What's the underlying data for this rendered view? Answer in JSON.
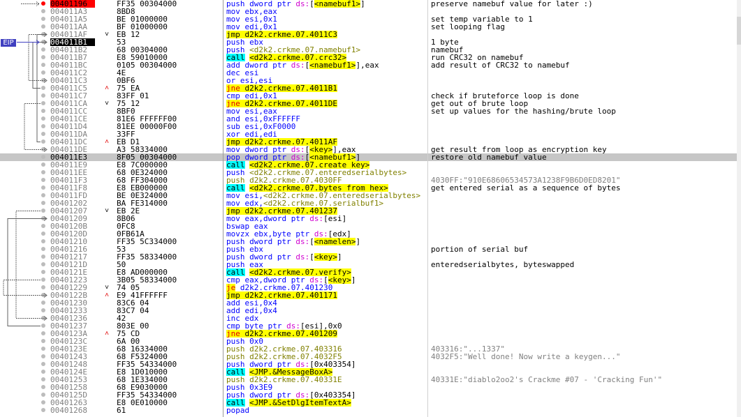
{
  "eip_label": "EIP",
  "rows": [
    {
      "addr": "00401196",
      "bytes": "FF35 00304000",
      "arrow": "",
      "ins": [
        [
          "push dword ptr ",
          ""
        ],
        [
          "ds:",
          "dk"
        ],
        [
          "[",
          "o"
        ],
        [
          "<namebuf1>",
          "sym"
        ],
        [
          "]",
          "o"
        ]
      ],
      "comment": "preserve namebuf value for later :)",
      "bp": true
    },
    {
      "addr": "004011A3",
      "bytes": "8BD8",
      "arrow": "",
      "ins": [
        [
          "mov ebx,eax",
          ""
        ]
      ],
      "comment": ""
    },
    {
      "addr": "004011A5",
      "bytes": "BE 01000000",
      "arrow": "",
      "ins": [
        [
          "mov esi,0x1",
          ""
        ]
      ],
      "comment": "set temp variable to 1"
    },
    {
      "addr": "004011AA",
      "bytes": "BF 01000000",
      "arrow": "",
      "ins": [
        [
          "mov edi,0x1",
          ""
        ]
      ],
      "comment": "set looping flag"
    },
    {
      "addr": "004011AF",
      "bytes": "EB 12",
      "arrow": "v",
      "ins": [
        [
          "jmp d2k2.crkme.07.4011C3",
          "jmp"
        ]
      ],
      "comment": ""
    },
    {
      "addr": "004011B1",
      "bytes": "53",
      "arrow": "",
      "ins": [
        [
          "push ebx",
          ""
        ]
      ],
      "comment": "1 byte",
      "eip": true
    },
    {
      "addr": "004011B2",
      "bytes": "68 00304000",
      "arrow": "",
      "ins": [
        [
          "push ",
          ""
        ],
        [
          "<d2k2.crkme.07.namebuf1>",
          "lbl"
        ]
      ],
      "comment": "namebuf"
    },
    {
      "addr": "004011B7",
      "bytes": "E8 59010000",
      "arrow": "",
      "ins": [
        [
          "call",
          "call"
        ],
        [
          " ",
          ""
        ],
        [
          "<d2k2.crkme.07.crc32>",
          "sym"
        ]
      ],
      "comment": "run CRC32 on namebuf"
    },
    {
      "addr": "004011BC",
      "bytes": "0105 00304000",
      "arrow": "",
      "ins": [
        [
          "add dword ptr ",
          ""
        ],
        [
          "ds:",
          "dk"
        ],
        [
          "[",
          "o"
        ],
        [
          "<namebuf1>",
          "sym"
        ],
        [
          "],eax",
          "o"
        ]
      ],
      "comment": "add result of CRC32 to namebuf"
    },
    {
      "addr": "004011C2",
      "bytes": "4E",
      "arrow": "",
      "ins": [
        [
          "dec esi",
          ""
        ]
      ],
      "comment": ""
    },
    {
      "addr": "004011C3",
      "bytes": "0BF6",
      "arrow": "",
      "ins": [
        [
          "or esi,esi",
          ""
        ]
      ],
      "comment": ""
    },
    {
      "addr": "004011C5",
      "bytes": "75 EA",
      "arrow": "^",
      "ins": [
        [
          "jne",
          "jcc"
        ],
        [
          " d2k2.crkme.07.4011B1",
          "jmp"
        ]
      ],
      "comment": ""
    },
    {
      "addr": "004011C7",
      "bytes": "83FF 01",
      "arrow": "",
      "ins": [
        [
          "cmp edi,0x1",
          ""
        ]
      ],
      "comment": "check if bruteforce loop is done"
    },
    {
      "addr": "004011CA",
      "bytes": "75 12",
      "arrow": "v",
      "ins": [
        [
          "jne",
          "jcc"
        ],
        [
          " d2k2.crkme.07.4011DE",
          "jmp"
        ]
      ],
      "comment": "get out of brute loop"
    },
    {
      "addr": "004011CC",
      "bytes": "8BF0",
      "arrow": "",
      "ins": [
        [
          "mov esi,eax",
          ""
        ]
      ],
      "comment": "set up values for the hashing/brute loop"
    },
    {
      "addr": "004011CE",
      "bytes": "81E6 FFFFFF00",
      "arrow": "",
      "ins": [
        [
          "and esi,0xFFFFFF",
          ""
        ]
      ],
      "comment": ""
    },
    {
      "addr": "004011D4",
      "bytes": "81EE 00000F00",
      "arrow": "",
      "ins": [
        [
          "sub esi,0xF0000",
          ""
        ]
      ],
      "comment": ""
    },
    {
      "addr": "004011DA",
      "bytes": "33FF",
      "arrow": "",
      "ins": [
        [
          "xor edi,edi",
          ""
        ]
      ],
      "comment": ""
    },
    {
      "addr": "004011DC",
      "bytes": "EB D1",
      "arrow": "^",
      "ins": [
        [
          "jmp d2k2.crkme.07.4011AF",
          "jmp"
        ]
      ],
      "comment": ""
    },
    {
      "addr": "004011DE",
      "bytes": "A3 58334000",
      "arrow": "",
      "ins": [
        [
          "mov dword ptr ",
          ""
        ],
        [
          "ds:",
          "dk"
        ],
        [
          "[",
          "o"
        ],
        [
          "<key>",
          "sym"
        ],
        [
          "],eax",
          "o"
        ]
      ],
      "comment": "get result from loop as encryption key"
    },
    {
      "addr": "004011E3",
      "bytes": "8F05 00304000",
      "arrow": "",
      "ins": [
        [
          "pop dword ptr ",
          ""
        ],
        [
          "ds:",
          "dk"
        ],
        [
          "[",
          "o"
        ],
        [
          "<namebuf1>",
          "sym"
        ],
        [
          "]",
          "o"
        ]
      ],
      "comment": "restore old namebuf value",
      "hl": true
    },
    {
      "addr": "004011E9",
      "bytes": "E8 7C000000",
      "arrow": "",
      "ins": [
        [
          "call",
          "call"
        ],
        [
          " ",
          ""
        ],
        [
          "<d2k2.crkme.07.create_key>",
          "sym"
        ]
      ],
      "comment": ""
    },
    {
      "addr": "004011EE",
      "bytes": "68 0E324000",
      "arrow": "",
      "ins": [
        [
          "push ",
          ""
        ],
        [
          "<d2k2.crkme.07.enteredserialbytes>",
          "lbl"
        ]
      ],
      "comment": ""
    },
    {
      "addr": "004011F3",
      "bytes": "68 FF304000",
      "arrow": "",
      "ins": [
        [
          "push d2k2.crkme.07.4030FF",
          "lbl"
        ]
      ],
      "comment": "4030FF:\"910E68606534573A1238F9B6D0ED8201\"",
      "cstr": true
    },
    {
      "addr": "004011F8",
      "bytes": "E8 EB000000",
      "arrow": "",
      "ins": [
        [
          "call",
          "call"
        ],
        [
          " ",
          ""
        ],
        [
          "<d2k2.crkme.07.bytes_from_hex>",
          "sym"
        ]
      ],
      "comment": "get entered serial as a sequence of bytes"
    },
    {
      "addr": "004011FD",
      "bytes": "BE 0E324000",
      "arrow": "",
      "ins": [
        [
          "mov esi,",
          ""
        ],
        [
          "<d2k2.crkme.07.enteredserialbytes>",
          "lbl"
        ]
      ],
      "comment": ""
    },
    {
      "addr": "00401202",
      "bytes": "BA FE314000",
      "arrow": "",
      "ins": [
        [
          "mov edx,",
          ""
        ],
        [
          "<d2k2.crkme.07.serialbuf1>",
          "lbl"
        ]
      ],
      "comment": ""
    },
    {
      "addr": "00401207",
      "bytes": "EB 2E",
      "arrow": "v",
      "ins": [
        [
          "jmp d2k2.crkme.07.401237",
          "jmp"
        ]
      ],
      "comment": ""
    },
    {
      "addr": "00401209",
      "bytes": "8B06",
      "arrow": "",
      "ins": [
        [
          "mov eax,dword ptr ",
          ""
        ],
        [
          "ds:",
          "dk"
        ],
        [
          "[esi]",
          "o"
        ]
      ],
      "comment": ""
    },
    {
      "addr": "0040120B",
      "bytes": "0FC8",
      "arrow": "",
      "ins": [
        [
          "bswap eax",
          ""
        ]
      ],
      "comment": ""
    },
    {
      "addr": "0040120D",
      "bytes": "0FB61A",
      "arrow": "",
      "ins": [
        [
          "movzx ebx,byte ptr ",
          ""
        ],
        [
          "ds:",
          "dk"
        ],
        [
          "[edx]",
          "o"
        ]
      ],
      "comment": ""
    },
    {
      "addr": "00401210",
      "bytes": "FF35 5C334000",
      "arrow": "",
      "ins": [
        [
          "push dword ptr ",
          ""
        ],
        [
          "ds:",
          "dk"
        ],
        [
          "[",
          "o"
        ],
        [
          "<namelen>",
          "sym"
        ],
        [
          "]",
          "o"
        ]
      ],
      "comment": ""
    },
    {
      "addr": "00401216",
      "bytes": "53",
      "arrow": "",
      "ins": [
        [
          "push ebx",
          ""
        ]
      ],
      "comment": "portion of serial buf"
    },
    {
      "addr": "00401217",
      "bytes": "FF35 58334000",
      "arrow": "",
      "ins": [
        [
          "push dword ptr ",
          ""
        ],
        [
          "ds:",
          "dk"
        ],
        [
          "[",
          "o"
        ],
        [
          "<key>",
          "sym"
        ],
        [
          "]",
          "o"
        ]
      ],
      "comment": ""
    },
    {
      "addr": "0040121D",
      "bytes": "50",
      "arrow": "",
      "ins": [
        [
          "push eax",
          ""
        ]
      ],
      "comment": "enteredserialbytes, byteswapped"
    },
    {
      "addr": "0040121E",
      "bytes": "E8 AD000000",
      "arrow": "",
      "ins": [
        [
          "call",
          "call"
        ],
        [
          " ",
          ""
        ],
        [
          "<d2k2.crkme.07.verify>",
          "sym"
        ]
      ],
      "comment": ""
    },
    {
      "addr": "00401223",
      "bytes": "3B05 58334000",
      "arrow": "",
      "ins": [
        [
          "cmp eax,dword ptr ",
          ""
        ],
        [
          "ds:",
          "dk"
        ],
        [
          "[",
          "o"
        ],
        [
          "<key>",
          "sym"
        ],
        [
          "]",
          "o"
        ]
      ],
      "comment": ""
    },
    {
      "addr": "00401229",
      "bytes": "74 05",
      "arrow": "v",
      "ins": [
        [
          "je",
          "jcc"
        ],
        [
          " d2k2.crkme.07.401230",
          ""
        ]
      ],
      "comment": ""
    },
    {
      "addr": "0040122B",
      "bytes": "E9 41FFFFFF",
      "arrow": "^",
      "ins": [
        [
          "jmp d2k2.crkme.07.401171",
          "jmp"
        ]
      ],
      "comment": ""
    },
    {
      "addr": "00401230",
      "bytes": "83C6 04",
      "arrow": "",
      "ins": [
        [
          "add esi,0x4",
          ""
        ]
      ],
      "comment": ""
    },
    {
      "addr": "00401233",
      "bytes": "83C7 04",
      "arrow": "",
      "ins": [
        [
          "add edi,0x4",
          ""
        ]
      ],
      "comment": ""
    },
    {
      "addr": "00401236",
      "bytes": "42",
      "arrow": "",
      "ins": [
        [
          "inc edx",
          ""
        ]
      ],
      "comment": ""
    },
    {
      "addr": "00401237",
      "bytes": "803E 00",
      "arrow": "",
      "ins": [
        [
          "cmp byte ptr ",
          ""
        ],
        [
          "ds:",
          "dk"
        ],
        [
          "[esi],0x0",
          "o"
        ]
      ],
      "comment": ""
    },
    {
      "addr": "0040123A",
      "bytes": "75 CD",
      "arrow": "^",
      "ins": [
        [
          "jne",
          "jcc"
        ],
        [
          " d2k2.crkme.07.401209",
          "jmp"
        ]
      ],
      "comment": ""
    },
    {
      "addr": "0040123C",
      "bytes": "6A 00",
      "arrow": "",
      "ins": [
        [
          "push 0x0",
          ""
        ]
      ],
      "comment": ""
    },
    {
      "addr": "0040123E",
      "bytes": "68 16334000",
      "arrow": "",
      "ins": [
        [
          "push d2k2.crkme.07.403316",
          "lbl"
        ]
      ],
      "comment": "403316:\"...1337\"",
      "cstr": true
    },
    {
      "addr": "00401243",
      "bytes": "68 F5324000",
      "arrow": "",
      "ins": [
        [
          "push d2k2.crkme.07.4032F5",
          "lbl"
        ]
      ],
      "comment": "4032F5:\"Well done! Now write a keygen...\"",
      "cstr": true
    },
    {
      "addr": "00401248",
      "bytes": "FF35 54334000",
      "arrow": "",
      "ins": [
        [
          "push dword ptr ",
          ""
        ],
        [
          "ds:",
          "dk"
        ],
        [
          "[0x403354]",
          "o"
        ]
      ],
      "comment": ""
    },
    {
      "addr": "0040124E",
      "bytes": "E8 1D010000",
      "arrow": "",
      "ins": [
        [
          "call",
          "call"
        ],
        [
          " ",
          ""
        ],
        [
          "<JMP.&MessageBoxA>",
          "sym"
        ]
      ],
      "comment": ""
    },
    {
      "addr": "00401253",
      "bytes": "68 1E334000",
      "arrow": "",
      "ins": [
        [
          "push d2k2.crkme.07.40331E",
          "lbl"
        ]
      ],
      "comment": "40331E:\"diablo2oo2's Crackme #07 - 'Cracking Fun'\"",
      "cstr": true
    },
    {
      "addr": "00401258",
      "bytes": "68 E9030000",
      "arrow": "",
      "ins": [
        [
          "push 0x3E9",
          ""
        ]
      ],
      "comment": ""
    },
    {
      "addr": "0040125D",
      "bytes": "FF35 54334000",
      "arrow": "",
      "ins": [
        [
          "push dword ptr ",
          ""
        ],
        [
          "ds:",
          "dk"
        ],
        [
          "[0x403354]",
          "o"
        ]
      ],
      "comment": ""
    },
    {
      "addr": "00401263",
      "bytes": "E8 0E010000",
      "arrow": "",
      "ins": [
        [
          "call",
          "call"
        ],
        [
          " ",
          ""
        ],
        [
          "<JMP.&SetDlgItemTextA>",
          "sym"
        ]
      ],
      "comment": ""
    },
    {
      "addr": "00401268",
      "bytes": "61",
      "arrow": "",
      "ins": [
        [
          "popad",
          ""
        ]
      ],
      "comment": ""
    }
  ],
  "colors": {
    "breakpoint": "#ff0000",
    "eip_addr": "#000000",
    "highlight_row": "#c6c6c6",
    "jump": "#ffff00",
    "call": "#00ffff",
    "cond_jump_text": "#e00000"
  }
}
